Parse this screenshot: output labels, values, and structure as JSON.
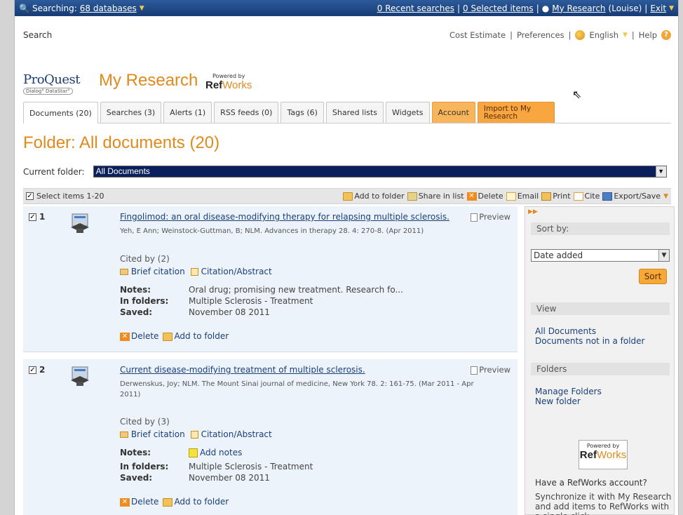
{
  "topbar": {
    "searching_prefix": "Searching:",
    "databases": "68 databases",
    "recent": "0 Recent searches",
    "selected": "0 Selected items",
    "my_research": "My Research",
    "user": "(Louise)",
    "exit": "Exit"
  },
  "header": {
    "search_link": "Search",
    "cost_estimate": "Cost Estimate",
    "preferences": "Preferences",
    "language": "English",
    "help": "Help",
    "logo_main": "ProQuest",
    "logo_sub": "Dialog° DataStar°",
    "page_title": "My Research",
    "powered_by": "Powered by",
    "refworks_ref": "Ref",
    "refworks_works": "Works"
  },
  "tabs": [
    {
      "label": "Documents (20)"
    },
    {
      "label": "Searches (3)"
    },
    {
      "label": "Alerts (1)"
    },
    {
      "label": "RSS feeds (0)"
    },
    {
      "label": "Tags (6)"
    },
    {
      "label": "Shared lists"
    },
    {
      "label": "Widgets"
    },
    {
      "label": "Account"
    },
    {
      "label": "Import to My Research"
    }
  ],
  "folder": {
    "title": "Folder: All documents (20)",
    "current_label": "Current folder:",
    "current_value": "All Documents"
  },
  "actionbar": {
    "select": "Select items 1-20",
    "add_folder": "Add to folder",
    "share": "Share in list",
    "delete": "Delete",
    "email": "Email",
    "print": "Print",
    "cite": "Cite",
    "export": "Export/Save"
  },
  "results": [
    {
      "num": "1",
      "title": "Fingolimod: an oral disease-modifying therapy for relapsing multiple sclerosis.",
      "meta": "Yeh, E Ann; Weinstock-Guttman, B; NLM. Advances in therapy 28. 4: 270-8. (Apr 2011)",
      "preview": "Preview",
      "cited": "Cited by (2)",
      "brief": "Brief citation",
      "abstract": "Citation/Abstract",
      "notes_label": "Notes:",
      "notes": "Oral drug; promising new treatment. Research fo...",
      "folders_label": "In folders:",
      "folders": "Multiple Sclerosis - Treatment",
      "saved_label": "Saved:",
      "saved": "November 08 2011",
      "delete": "Delete",
      "add_folder": "Add to folder"
    },
    {
      "num": "2",
      "title": "Current disease-modifying treatment of multiple sclerosis.",
      "meta": "Derwenskus, Joy; NLM. The Mount Sinai journal of medicine, New York 78. 2: 161-75. (Mar 2011 - Apr 2011)",
      "preview": "Preview",
      "cited": "Cited by (3)",
      "brief": "Brief citation",
      "abstract": "Citation/Abstract",
      "notes_label": "Notes:",
      "notes": "Add notes",
      "folders_label": "In folders:",
      "folders": "Multiple Sclerosis - Treatment",
      "saved_label": "Saved:",
      "saved": "November 08 2011",
      "delete": "Delete",
      "add_folder": "Add to folder"
    }
  ],
  "sidebar": {
    "sort_by": "Sort by:",
    "sort_value": "Date added",
    "sort_button": "Sort",
    "view": "View",
    "all_documents": "All Documents",
    "not_in_folder": "Documents not in a folder",
    "folders": "Folders",
    "manage_folders": "Manage Folders",
    "new_folder": "New folder",
    "rw_question": "Have a RefWorks account?",
    "rw_sync": "Synchronize it with My Research and add items to RefWorks with a single click"
  }
}
